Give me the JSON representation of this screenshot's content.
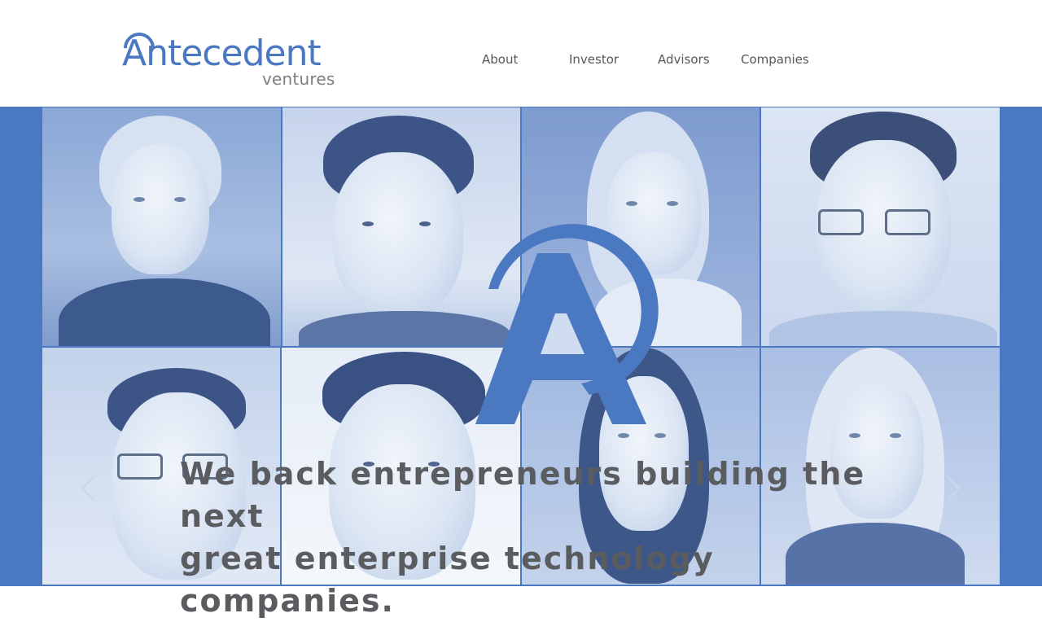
{
  "header": {
    "logo": {
      "main": "Antecedent",
      "sub": "ventures",
      "name": "antecedent-ventures-logo"
    },
    "nav": [
      {
        "label": "About"
      },
      {
        "label": "Investor"
      },
      {
        "label": "Advisors"
      },
      {
        "label": "Companies"
      }
    ]
  },
  "hero": {
    "tagline_line1": "We back entrepreneurs building the next",
    "tagline_line2": "great enterprise technology companies.",
    "prev_icon": "chevron-left-icon",
    "next_icon": "chevron-right-icon",
    "overlay_logo": "antecedent-a-mark"
  },
  "colors": {
    "brand_blue": "#4a79c2",
    "nav_text": "#575757",
    "tagline_text": "#5a5c60",
    "tile_tint": "#c9d7ee"
  }
}
